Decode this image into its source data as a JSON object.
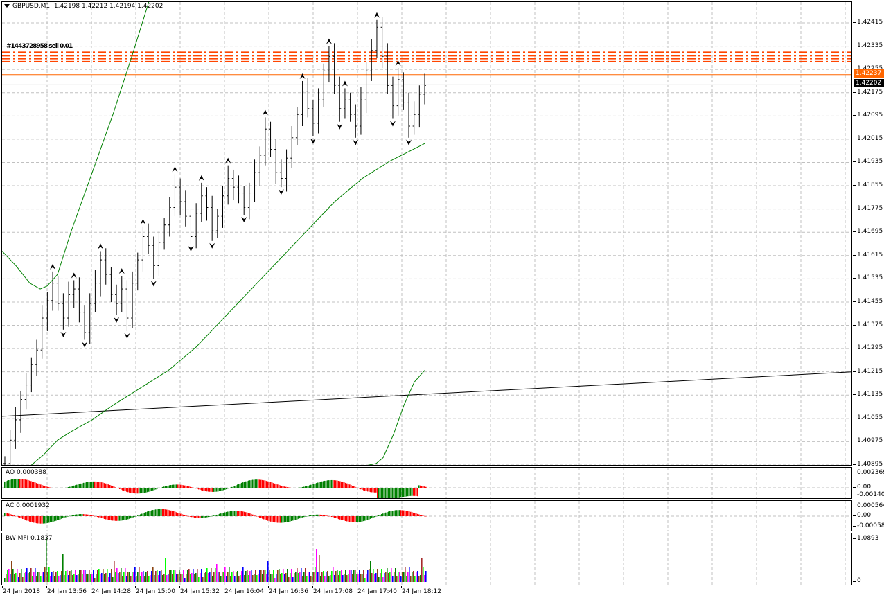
{
  "symbol": {
    "title": "GBPUSD,M1",
    "ohlc": "1.42198 1.42212 1.42194 1.42202",
    "overlap_text": "#1443728958 sell 0.01"
  },
  "main": {
    "price_ticks": [
      "1.42415",
      "1.42335",
      "1.42255",
      "1.42175",
      "1.42095",
      "1.42015",
      "1.41935",
      "1.41855",
      "1.41775",
      "1.41695",
      "1.41615",
      "1.41535",
      "1.41455",
      "1.41375",
      "1.41295",
      "1.41215",
      "1.41135",
      "1.41055",
      "1.40975",
      "1.40895"
    ],
    "price_min": 1.40895,
    "price_max": 1.42415,
    "price_tag_orange": "1.42237",
    "price_tag_current": "1.42202",
    "order_levels": [
      1.42314,
      1.42302,
      1.42292,
      1.42282
    ],
    "colors": {
      "grid": "#c0c0c0",
      "candle": "#000000",
      "ma": "#008000",
      "trend": "#000000",
      "order_line": "#ff4500",
      "orange_line": "#ff6600",
      "tag_orange_bg": "#ff6600",
      "tag_current_bg": "#000000"
    },
    "chart_data": {
      "type": "line",
      "series": [
        {
          "values": [
            1.409,
            1.4098,
            1.4105,
            1.4112,
            1.4117,
            1.4124,
            1.4129,
            1.414,
            1.4146,
            1.4152,
            1.4145,
            1.414,
            1.4148,
            1.415,
            1.4142,
            1.4135,
            1.4145,
            1.4152,
            1.416,
            1.4155,
            1.4148,
            1.4145,
            1.415,
            1.414,
            1.4152,
            1.416,
            1.4168,
            1.4165,
            1.4158,
            1.4166,
            1.4172,
            1.4178,
            1.4185,
            1.418,
            1.4175,
            1.4168,
            1.4176,
            1.4182,
            1.4178,
            1.417,
            1.4175,
            1.4182,
            1.4188,
            1.4185,
            1.4183,
            1.4178,
            1.4183,
            1.419,
            1.4196,
            1.4205,
            1.4198,
            1.419,
            1.4188,
            1.4195,
            1.4202,
            1.421,
            1.4218,
            1.4212,
            1.4207,
            1.4215,
            1.4225,
            1.423,
            1.422,
            1.4212,
            1.4215,
            1.421,
            1.4206,
            1.4215,
            1.4225,
            1.4232,
            1.424,
            1.423,
            1.422,
            1.4213,
            1.4222,
            1.4214,
            1.4206,
            1.421,
            1.4217,
            1.422
          ]
        }
      ]
    }
  },
  "ao": {
    "label": "AO 0.000388",
    "ticks": [
      "0.002369",
      "0.00",
      "-0.001404"
    ]
  },
  "ac": {
    "label": "AC 0.0001932",
    "ticks": [
      "0.000564",
      "0.00",
      "-0.000580"
    ]
  },
  "mfi": {
    "label": "BW MFI 0.1837",
    "ticks": [
      "1.0893",
      "0"
    ]
  },
  "time_labels": [
    "24 Jan 2018",
    "24 Jan 13:56",
    "24 Jan 14:28",
    "24 Jan 15:00",
    "24 Jan 15:32",
    "24 Jan 16:04",
    "24 Jan 16:36",
    "24 Jan 17:08",
    "24 Jan 17:40",
    "24 Jan 18:12"
  ]
}
